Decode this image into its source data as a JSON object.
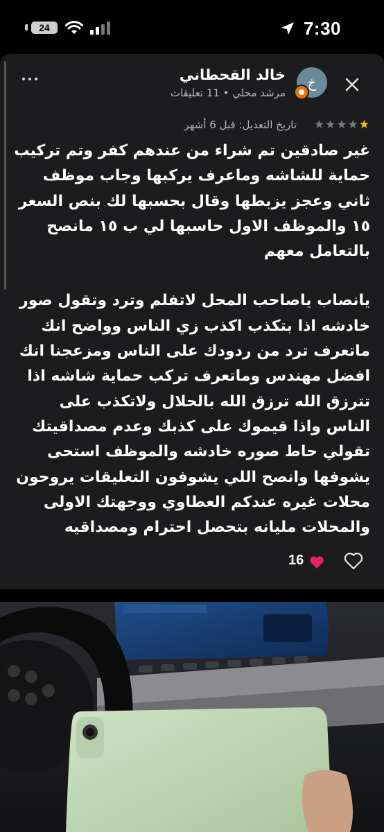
{
  "status_bar": {
    "time": "7:30",
    "battery_level": "24"
  },
  "review": {
    "author_name": "خالد القحطاني",
    "author_initial": "خ",
    "author_meta": "مرشد محلي • 11 تعليقات",
    "rating": 1,
    "rating_max": 5,
    "edit_date": "تاريخ التعديل: قبل 6 أشهر",
    "paragraph_1": "غير صادقين تم شراء من عندهم كفر وتم تركيب حماية للشاشه وماعرف يركبها  وجاب موظف ثاني وعجز يزبطها وقال بحسبها لك بنص السعر ١٥ والموظف  الاول حاسبها لي  ب ١٥ مانصح بالتعامل معهم",
    "paragraph_2": "يانصاب ياصاحب المحل لاتفلم وترد وتقول صور خادشه اذا بتكذب اكذب زي الناس وواضح انك ماتعرف ترد من ردودك على الناس  ومزعجنا انك افضل مهندس وماتعرف تركب حماية شاشه  اذا تترزق الله ترزق الله بالحلال ولاتكذب على الناس واذا قيموك على كذبك وعدم مصداقيتك  تقولي حاط صوره خادشه والموظف استحى يشوفها وانصح اللي يشوفون التعليقات يروحون محلات غيره عندكم العطاوي ووجهتك الاولى والمحلات مليانه بتحصل احترام ومصداقيه",
    "like_count": "16"
  },
  "colors": {
    "card_bg": "#1c1c1e",
    "star_filled": "#f4c20d",
    "badge": "#e8710a",
    "heart": "#e0245e"
  },
  "icons": [
    "close-icon",
    "more-icon",
    "heart-emoji-icon",
    "like-heart-icon",
    "location-arrow-icon",
    "wifi-icon",
    "signal-icon",
    "battery-icon"
  ]
}
